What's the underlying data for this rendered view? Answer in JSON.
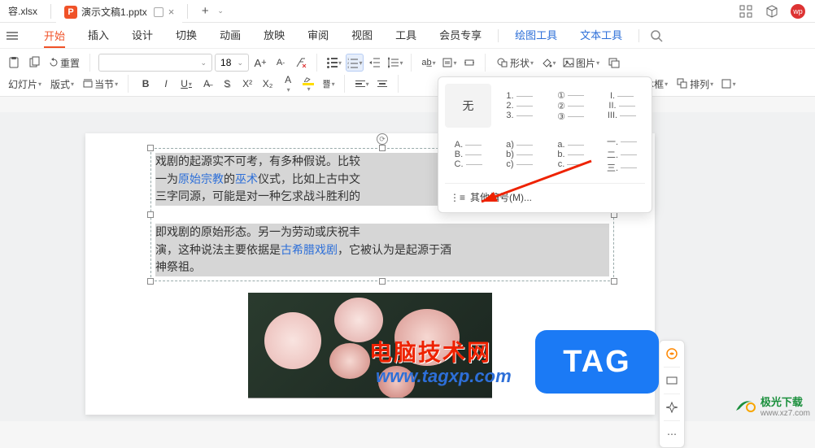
{
  "titlebar": {
    "tab1": "容.xlsx",
    "tab2": "演示文稿1.pptx",
    "p_icon": "P"
  },
  "menubar": {
    "items": [
      "开始",
      "插入",
      "设计",
      "切换",
      "动画",
      "放映",
      "审阅",
      "视图",
      "工具",
      "会员专享"
    ],
    "right_items": [
      "绘图工具",
      "文本工具"
    ]
  },
  "toolbar": {
    "reset": "重置",
    "font_size": "18",
    "slide_label": "幻灯片",
    "format_label": "版式",
    "section_label": "当节",
    "changecase": "쁠",
    "shape_label": "形状",
    "image_label": "图片",
    "textbox_label": "文本框",
    "arrange_label": "排列"
  },
  "popup": {
    "none": "无",
    "grid": [
      [
        "1.",
        "2.",
        "3."
      ],
      [
        "①",
        "②",
        "③"
      ],
      [
        "I.",
        "II.",
        "III."
      ],
      [
        "A.",
        "B.",
        "C."
      ],
      [
        "a)",
        "b)",
        "c)"
      ],
      [
        "a.",
        "b.",
        "c."
      ],
      [
        "一.",
        "二.",
        "三."
      ]
    ],
    "footer_icon": "⋮≡",
    "footer": "其他编号(M)..."
  },
  "content": {
    "p1a": "戏剧的起源实不可考，有多种假说。比较",
    "p1b": "一为",
    "p1_link1": "原始宗教",
    "p1c": "的",
    "p1_link2": "巫术",
    "p1d": "仪式，比如上古中文",
    "p1e": "三字同源，可能是对一种乞求战斗胜利的",
    "p2a": "即戏剧的原始形态。另一为劳动或庆祝丰",
    "p2b": "演，这种说法主要依据是",
    "p2_link": "古希腊戏剧",
    "p2c": "，它被认为是起源于酒",
    "p2d": "神祭祖。"
  },
  "watermark": {
    "title": "电脑技术网",
    "url": "www.tagxp.com",
    "tag": "TAG",
    "jg_name": "极光下载",
    "jg_url": "www.xz7.com"
  }
}
